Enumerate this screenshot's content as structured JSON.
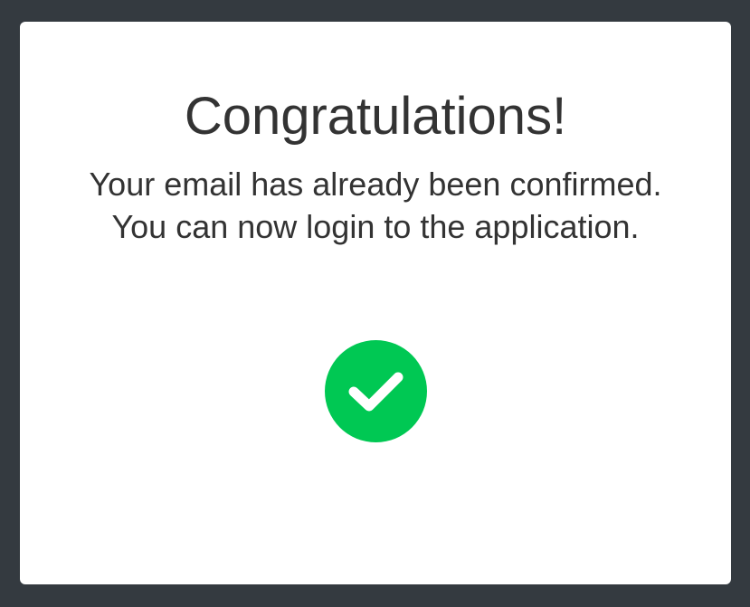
{
  "card": {
    "title": "Congratulations!",
    "message": "Your email has already been confirmed. You can now login to the application.",
    "status_icon": "check-circle-icon",
    "success_color": "#00c853"
  },
  "colors": {
    "background": "#343a40",
    "card": "#ffffff",
    "text": "#333333"
  }
}
